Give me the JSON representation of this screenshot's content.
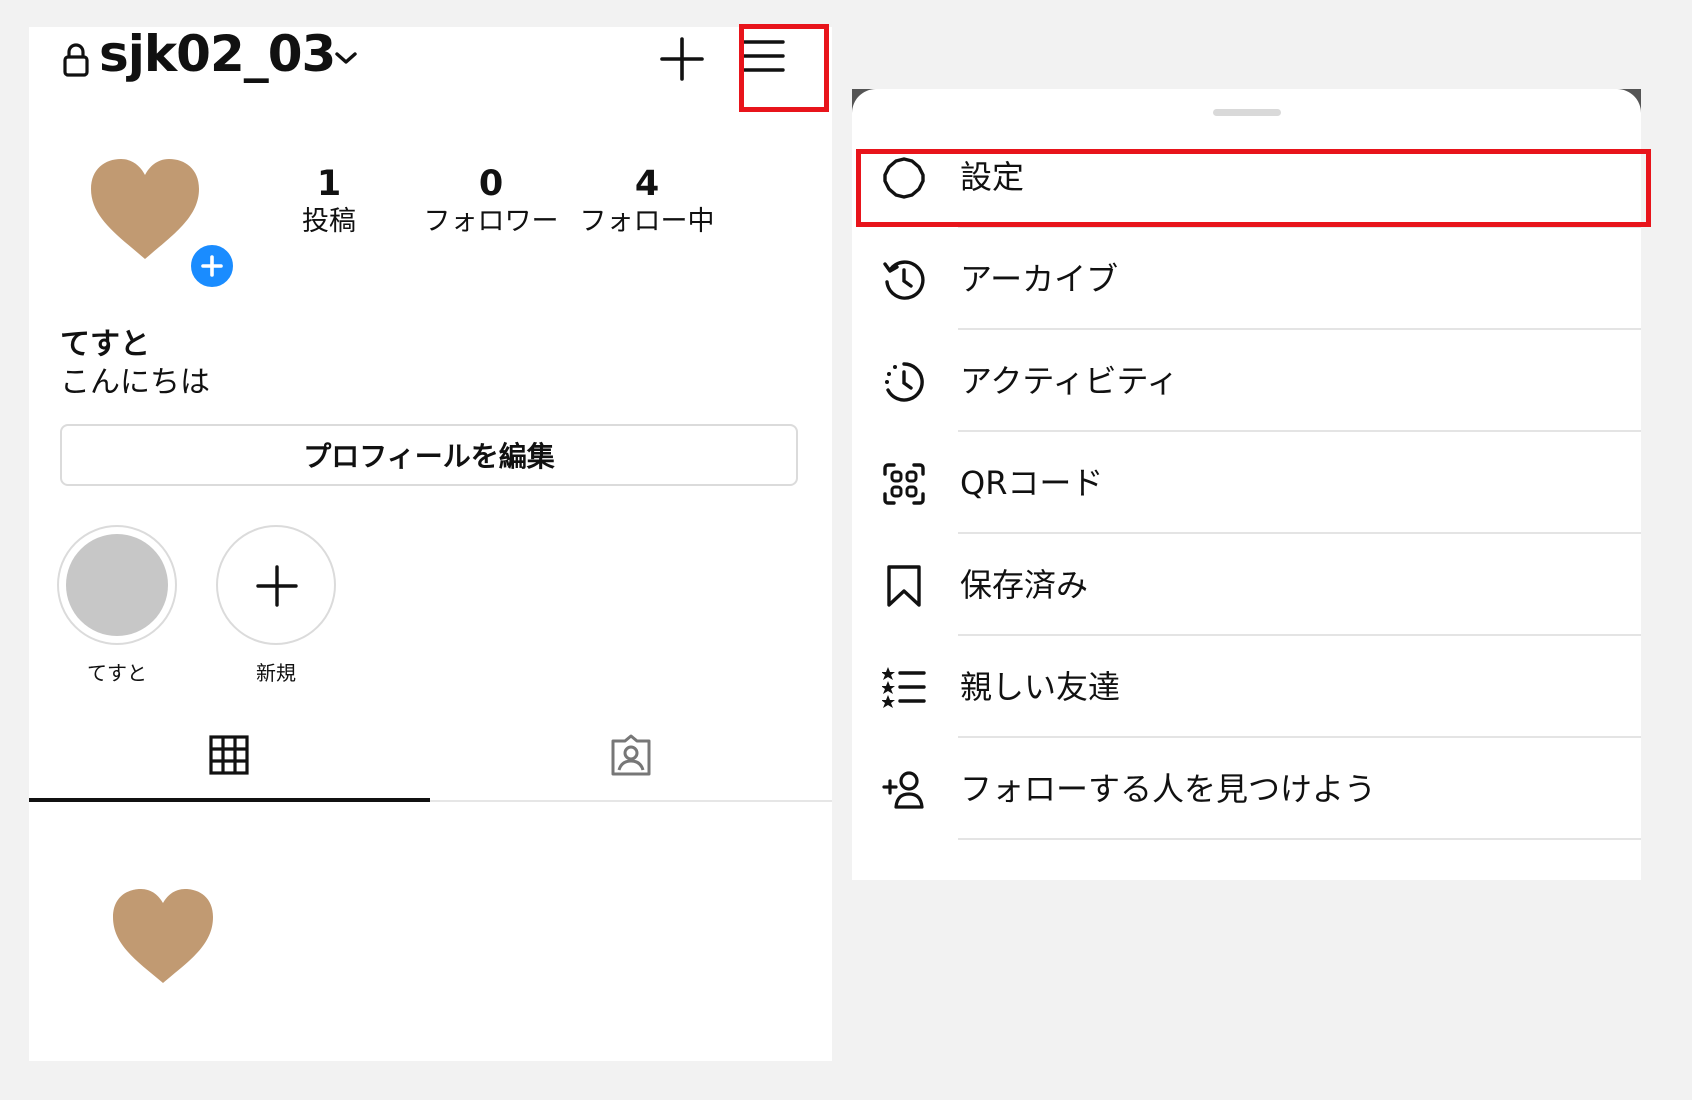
{
  "profile": {
    "username": "sjk02_03",
    "display_name": "てすと",
    "bio": "こんにちは",
    "edit_button": "プロフィールを編集",
    "stats": [
      {
        "value": "1",
        "label": "投稿"
      },
      {
        "value": "0",
        "label": "フォロワー"
      },
      {
        "value": "4",
        "label": "フォロー中"
      }
    ],
    "highlights": [
      {
        "label": "てすと"
      },
      {
        "label": "新規"
      }
    ]
  },
  "colors": {
    "highlight_box": "#e8141b",
    "add_badge": "#1a8cff",
    "heart": "#c19a72"
  },
  "menu": {
    "items": [
      {
        "label": "設定",
        "icon": "settings-icon"
      },
      {
        "label": "アーカイブ",
        "icon": "archive-icon"
      },
      {
        "label": "アクティビティ",
        "icon": "activity-icon"
      },
      {
        "label": "QRコード",
        "icon": "qr-code-icon"
      },
      {
        "label": "保存済み",
        "icon": "bookmark-icon"
      },
      {
        "label": "親しい友達",
        "icon": "close-friends-icon"
      },
      {
        "label": "フォローする人を見つけよう",
        "icon": "add-person-icon"
      }
    ]
  }
}
